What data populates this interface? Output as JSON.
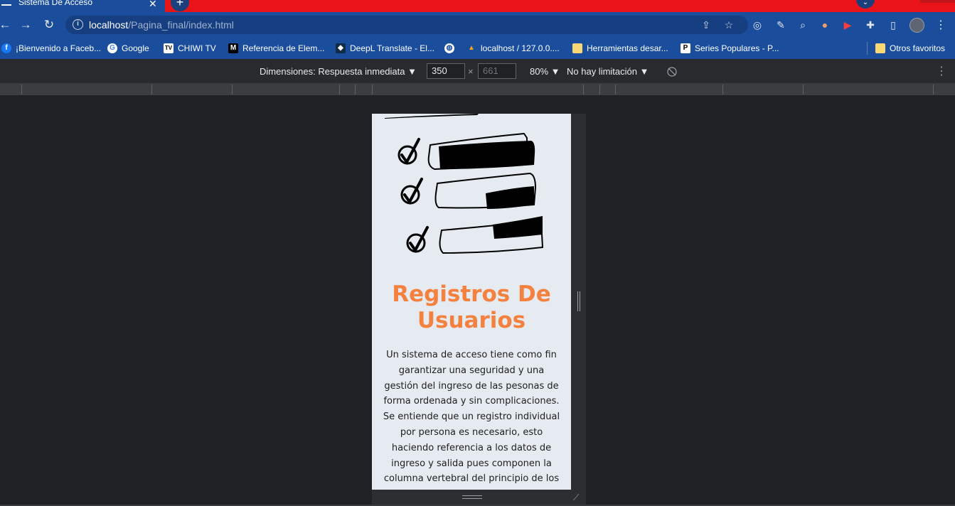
{
  "tab": {
    "title": "Sistema De Acceso",
    "close": "✕"
  },
  "newtab": "+",
  "tabsearch": "⌄",
  "toolbar": {
    "back": "←",
    "forward": "→",
    "reload": "↻",
    "url_host": "localhost",
    "url_path": "/Pagina_final/index.html",
    "info": "i",
    "menu": "⋮"
  },
  "bookmarks": [
    {
      "label": "¡Bienvenido a Faceb...",
      "icon": "facebook-icon",
      "glyph": "f",
      "color": "#1877f2"
    },
    {
      "label": "Google",
      "icon": "google-icon",
      "glyph": "G",
      "color": "#ffffff"
    },
    {
      "label": "CHIWI TV",
      "icon": "tv-icon",
      "glyph": "TV",
      "color": "#ffffff"
    },
    {
      "label": "Referencia de Elem...",
      "icon": "mdn-icon",
      "glyph": "M",
      "color": "#000000"
    },
    {
      "label": "DeepL Translate - El...",
      "icon": "deepl-icon",
      "glyph": "◆",
      "color": "#0f2b46"
    },
    {
      "label": "",
      "icon": "globe-icon",
      "glyph": "◍",
      "color": "#ffffff"
    },
    {
      "label": "localhost / 127.0.0....",
      "icon": "phpmyadmin-icon",
      "glyph": "▲",
      "color": "#f7a21b"
    },
    {
      "label": "Herramientas desar...",
      "icon": "folder-icon",
      "glyph": "",
      "color": "#f8d775"
    },
    {
      "label": "Series Populares - P...",
      "icon": "p-icon",
      "glyph": "P",
      "color": "#000000"
    }
  ],
  "other_bookmarks": "Otros favoritos",
  "devtools": {
    "dimensions_label": "Dimensiones: Respuesta inmediata ▼",
    "width": "350",
    "height_placeholder": "661",
    "times": "×",
    "zoom": "80% ▼",
    "throttle": "No hay limitación ▼",
    "more": "⋮"
  },
  "page": {
    "title": "Registros De Usuarios",
    "body": "Un sistema de acceso tiene como fin garantizar una seguridad y una gestión del ingreso de las pesonas de forma ordenada y sin complicaciones. Se entiende que un registro individual por persona es necesario, esto haciendo referencia a los datos de ingreso y salida pues componen la columna vertebral del principio de los"
  },
  "colors": {
    "browser_chrome": "#1a4e9c",
    "tab_strip": "#e8141a",
    "accent_title": "#f5813f",
    "viewport_bg": "#e6ebf1"
  }
}
